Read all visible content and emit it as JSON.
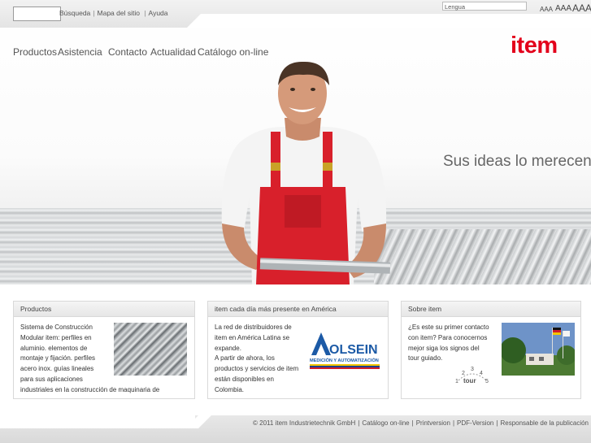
{
  "header": {
    "links": [
      "Búsqueda",
      "Mapa del sitio",
      "Ayuda"
    ],
    "language_label": "Lengua",
    "font_sizes": [
      "AAA",
      "AAA",
      "AAA"
    ]
  },
  "nav": {
    "items": [
      "Productos",
      "Asistencia",
      "Contacto",
      "Actualidad",
      "Catálogo on-line"
    ]
  },
  "logo": {
    "text": "item",
    "color": "#e3001b"
  },
  "hero": {
    "tagline": "Sus ideas lo merecen"
  },
  "boxes": [
    {
      "title": "Productos",
      "lines": [
        "Sistema de Construcción",
        "Modular item: perfiles en",
        "aluminio. elementos de",
        "montaje y fijación. perfiles",
        "acero inox. guías lineales",
        "para sus aplicaciones",
        "industriales en la construcción de maquinaria de"
      ]
    },
    {
      "title": "item cada día más presente en América",
      "lines": [
        "La red de distribuidores de",
        "item en América Latina se",
        "expande.",
        "A partir de ahora, los",
        "productos y servicios de item",
        "están disponibles en",
        "Colombia."
      ],
      "logo_text": "OLSEIN",
      "logo_sub": "MEDICIÓN Y AUTOMATIZACIÓN"
    },
    {
      "title": "Sobre item",
      "lines": [
        "¿Es este su primer contacto",
        "con item? Para conocernos",
        "mejor siga los signos del",
        "tour guiado."
      ],
      "tour_label": "tour",
      "tour_steps": [
        "1",
        "2",
        "3",
        "4",
        "5"
      ]
    }
  ],
  "footer": {
    "copyright": "© 2011 item Industrietechnik GmbH",
    "links": [
      "Catálogo on-line",
      "Printversion",
      "PDF-Version",
      "Responsable de la publicación"
    ]
  }
}
